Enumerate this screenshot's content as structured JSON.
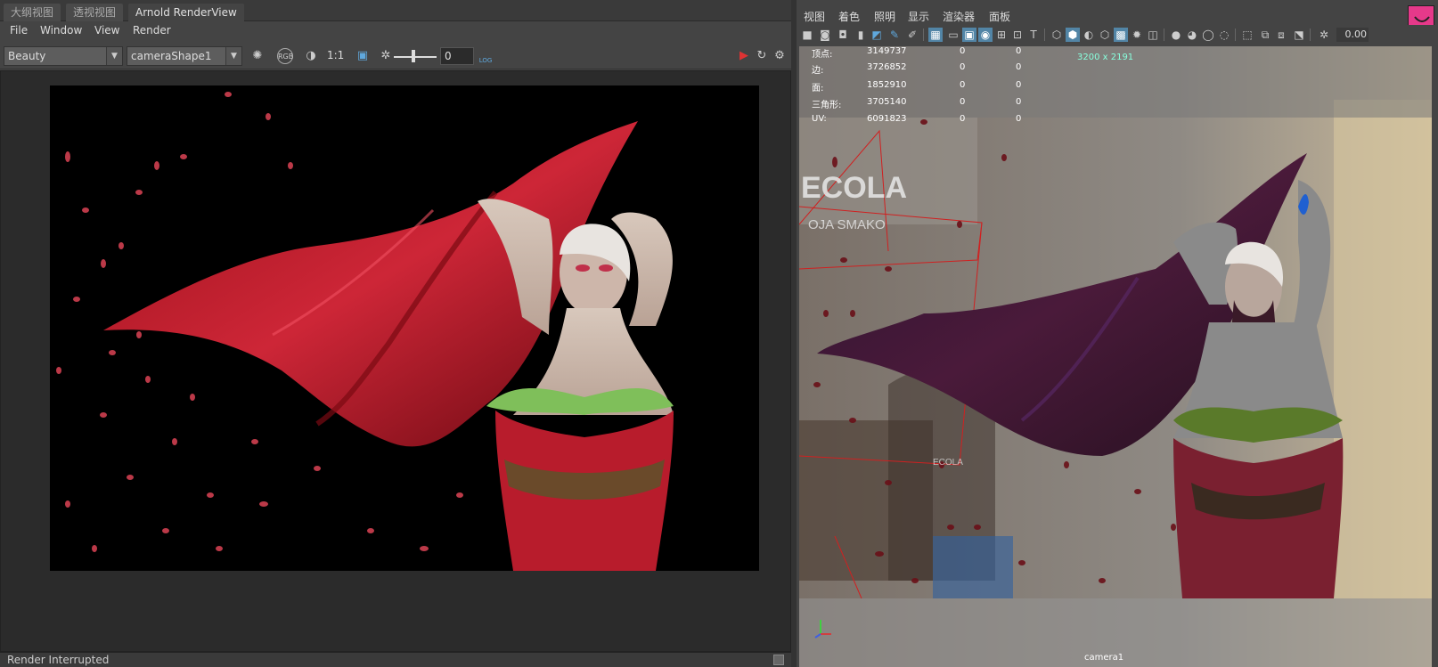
{
  "left": {
    "tabs": [
      {
        "label": "大纲视图"
      },
      {
        "label": "透视视图"
      },
      {
        "label": "Arnold RenderView"
      }
    ],
    "menu": [
      "File",
      "Window",
      "View",
      "Render"
    ],
    "toolbar": {
      "aov_value": "Beauty",
      "camera_value": "cameraShape1",
      "ratio_label": "1:1",
      "exposure_value": "0",
      "log_label": "LOG"
    },
    "status": "Render Interrupted"
  },
  "right": {
    "menu": [
      "视图",
      "着色",
      "照明",
      "显示",
      "渲染器",
      "面板"
    ],
    "field_value": "0.00",
    "hud": {
      "rows": [
        {
          "label": "顶点:",
          "a": "3149737",
          "b": "0",
          "c": "0"
        },
        {
          "label": "边:",
          "a": "3726852",
          "b": "0",
          "c": "0"
        },
        {
          "label": "面:",
          "a": "1852910",
          "b": "0",
          "c": "0"
        },
        {
          "label": "三角形:",
          "a": "3705140",
          "b": "0",
          "c": "0"
        },
        {
          "label": "UV:",
          "a": "6091823",
          "b": "0",
          "c": "0"
        }
      ],
      "resolution": "3200 x 2191"
    },
    "camera_label": "camera1",
    "sign_texts": [
      "ECOLA",
      "OJA SMAKO",
      "ECOLA"
    ]
  },
  "colors": {
    "accent_blue": "#5285a6",
    "pink_button": "#e6398a",
    "render_bg": "#000000"
  }
}
